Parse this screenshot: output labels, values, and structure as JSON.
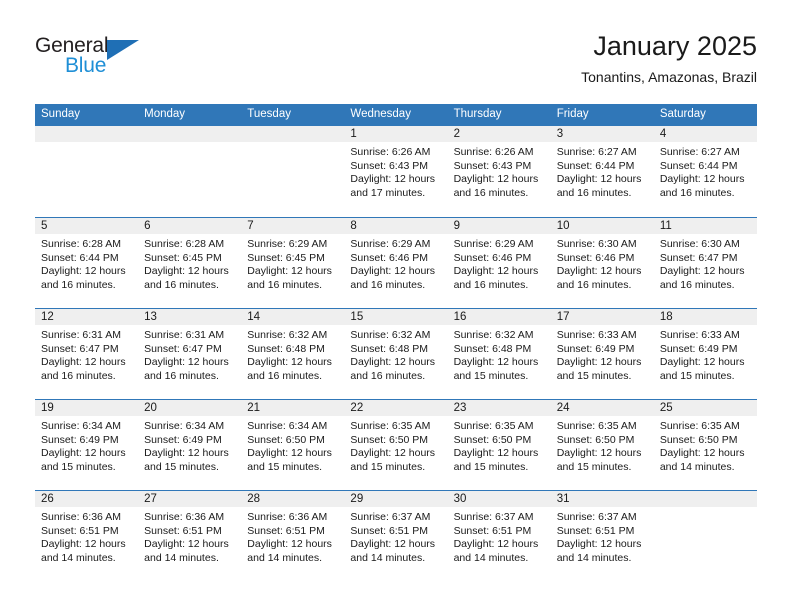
{
  "brand": {
    "name_part1": "General",
    "name_part2": "Blue",
    "triangle_icon": "triangle-icon",
    "accent_blue": "#1f6fb5",
    "light_blue": "#1f8fd6"
  },
  "header": {
    "title": "January 2025",
    "location": "Tonantins, Amazonas, Brazil"
  },
  "theme": {
    "header_blue": "#3077b8",
    "band_gray": "#efefef",
    "text": "#1a1a1a"
  },
  "weekdays": [
    "Sunday",
    "Monday",
    "Tuesday",
    "Wednesday",
    "Thursday",
    "Friday",
    "Saturday"
  ],
  "weeks": [
    [
      {
        "day": "",
        "empty": true,
        "sunrise": "",
        "sunset": "",
        "daylight1": "",
        "daylight2": ""
      },
      {
        "day": "",
        "empty": true,
        "sunrise": "",
        "sunset": "",
        "daylight1": "",
        "daylight2": ""
      },
      {
        "day": "",
        "empty": true,
        "sunrise": "",
        "sunset": "",
        "daylight1": "",
        "daylight2": ""
      },
      {
        "day": "1",
        "sunrise": "Sunrise: 6:26 AM",
        "sunset": "Sunset: 6:43 PM",
        "daylight1": "Daylight: 12 hours",
        "daylight2": "and 17 minutes."
      },
      {
        "day": "2",
        "sunrise": "Sunrise: 6:26 AM",
        "sunset": "Sunset: 6:43 PM",
        "daylight1": "Daylight: 12 hours",
        "daylight2": "and 16 minutes."
      },
      {
        "day": "3",
        "sunrise": "Sunrise: 6:27 AM",
        "sunset": "Sunset: 6:44 PM",
        "daylight1": "Daylight: 12 hours",
        "daylight2": "and 16 minutes."
      },
      {
        "day": "4",
        "sunrise": "Sunrise: 6:27 AM",
        "sunset": "Sunset: 6:44 PM",
        "daylight1": "Daylight: 12 hours",
        "daylight2": "and 16 minutes."
      }
    ],
    [
      {
        "day": "5",
        "sunrise": "Sunrise: 6:28 AM",
        "sunset": "Sunset: 6:44 PM",
        "daylight1": "Daylight: 12 hours",
        "daylight2": "and 16 minutes."
      },
      {
        "day": "6",
        "sunrise": "Sunrise: 6:28 AM",
        "sunset": "Sunset: 6:45 PM",
        "daylight1": "Daylight: 12 hours",
        "daylight2": "and 16 minutes."
      },
      {
        "day": "7",
        "sunrise": "Sunrise: 6:29 AM",
        "sunset": "Sunset: 6:45 PM",
        "daylight1": "Daylight: 12 hours",
        "daylight2": "and 16 minutes."
      },
      {
        "day": "8",
        "sunrise": "Sunrise: 6:29 AM",
        "sunset": "Sunset: 6:46 PM",
        "daylight1": "Daylight: 12 hours",
        "daylight2": "and 16 minutes."
      },
      {
        "day": "9",
        "sunrise": "Sunrise: 6:29 AM",
        "sunset": "Sunset: 6:46 PM",
        "daylight1": "Daylight: 12 hours",
        "daylight2": "and 16 minutes."
      },
      {
        "day": "10",
        "sunrise": "Sunrise: 6:30 AM",
        "sunset": "Sunset: 6:46 PM",
        "daylight1": "Daylight: 12 hours",
        "daylight2": "and 16 minutes."
      },
      {
        "day": "11",
        "sunrise": "Sunrise: 6:30 AM",
        "sunset": "Sunset: 6:47 PM",
        "daylight1": "Daylight: 12 hours",
        "daylight2": "and 16 minutes."
      }
    ],
    [
      {
        "day": "12",
        "sunrise": "Sunrise: 6:31 AM",
        "sunset": "Sunset: 6:47 PM",
        "daylight1": "Daylight: 12 hours",
        "daylight2": "and 16 minutes."
      },
      {
        "day": "13",
        "sunrise": "Sunrise: 6:31 AM",
        "sunset": "Sunset: 6:47 PM",
        "daylight1": "Daylight: 12 hours",
        "daylight2": "and 16 minutes."
      },
      {
        "day": "14",
        "sunrise": "Sunrise: 6:32 AM",
        "sunset": "Sunset: 6:48 PM",
        "daylight1": "Daylight: 12 hours",
        "daylight2": "and 16 minutes."
      },
      {
        "day": "15",
        "sunrise": "Sunrise: 6:32 AM",
        "sunset": "Sunset: 6:48 PM",
        "daylight1": "Daylight: 12 hours",
        "daylight2": "and 16 minutes."
      },
      {
        "day": "16",
        "sunrise": "Sunrise: 6:32 AM",
        "sunset": "Sunset: 6:48 PM",
        "daylight1": "Daylight: 12 hours",
        "daylight2": "and 15 minutes."
      },
      {
        "day": "17",
        "sunrise": "Sunrise: 6:33 AM",
        "sunset": "Sunset: 6:49 PM",
        "daylight1": "Daylight: 12 hours",
        "daylight2": "and 15 minutes."
      },
      {
        "day": "18",
        "sunrise": "Sunrise: 6:33 AM",
        "sunset": "Sunset: 6:49 PM",
        "daylight1": "Daylight: 12 hours",
        "daylight2": "and 15 minutes."
      }
    ],
    [
      {
        "day": "19",
        "sunrise": "Sunrise: 6:34 AM",
        "sunset": "Sunset: 6:49 PM",
        "daylight1": "Daylight: 12 hours",
        "daylight2": "and 15 minutes."
      },
      {
        "day": "20",
        "sunrise": "Sunrise: 6:34 AM",
        "sunset": "Sunset: 6:49 PM",
        "daylight1": "Daylight: 12 hours",
        "daylight2": "and 15 minutes."
      },
      {
        "day": "21",
        "sunrise": "Sunrise: 6:34 AM",
        "sunset": "Sunset: 6:50 PM",
        "daylight1": "Daylight: 12 hours",
        "daylight2": "and 15 minutes."
      },
      {
        "day": "22",
        "sunrise": "Sunrise: 6:35 AM",
        "sunset": "Sunset: 6:50 PM",
        "daylight1": "Daylight: 12 hours",
        "daylight2": "and 15 minutes."
      },
      {
        "day": "23",
        "sunrise": "Sunrise: 6:35 AM",
        "sunset": "Sunset: 6:50 PM",
        "daylight1": "Daylight: 12 hours",
        "daylight2": "and 15 minutes."
      },
      {
        "day": "24",
        "sunrise": "Sunrise: 6:35 AM",
        "sunset": "Sunset: 6:50 PM",
        "daylight1": "Daylight: 12 hours",
        "daylight2": "and 15 minutes."
      },
      {
        "day": "25",
        "sunrise": "Sunrise: 6:35 AM",
        "sunset": "Sunset: 6:50 PM",
        "daylight1": "Daylight: 12 hours",
        "daylight2": "and 14 minutes."
      }
    ],
    [
      {
        "day": "26",
        "sunrise": "Sunrise: 6:36 AM",
        "sunset": "Sunset: 6:51 PM",
        "daylight1": "Daylight: 12 hours",
        "daylight2": "and 14 minutes."
      },
      {
        "day": "27",
        "sunrise": "Sunrise: 6:36 AM",
        "sunset": "Sunset: 6:51 PM",
        "daylight1": "Daylight: 12 hours",
        "daylight2": "and 14 minutes."
      },
      {
        "day": "28",
        "sunrise": "Sunrise: 6:36 AM",
        "sunset": "Sunset: 6:51 PM",
        "daylight1": "Daylight: 12 hours",
        "daylight2": "and 14 minutes."
      },
      {
        "day": "29",
        "sunrise": "Sunrise: 6:37 AM",
        "sunset": "Sunset: 6:51 PM",
        "daylight1": "Daylight: 12 hours",
        "daylight2": "and 14 minutes."
      },
      {
        "day": "30",
        "sunrise": "Sunrise: 6:37 AM",
        "sunset": "Sunset: 6:51 PM",
        "daylight1": "Daylight: 12 hours",
        "daylight2": "and 14 minutes."
      },
      {
        "day": "31",
        "sunrise": "Sunrise: 6:37 AM",
        "sunset": "Sunset: 6:51 PM",
        "daylight1": "Daylight: 12 hours",
        "daylight2": "and 14 minutes."
      },
      {
        "day": "",
        "empty": true,
        "sunrise": "",
        "sunset": "",
        "daylight1": "",
        "daylight2": ""
      }
    ]
  ]
}
